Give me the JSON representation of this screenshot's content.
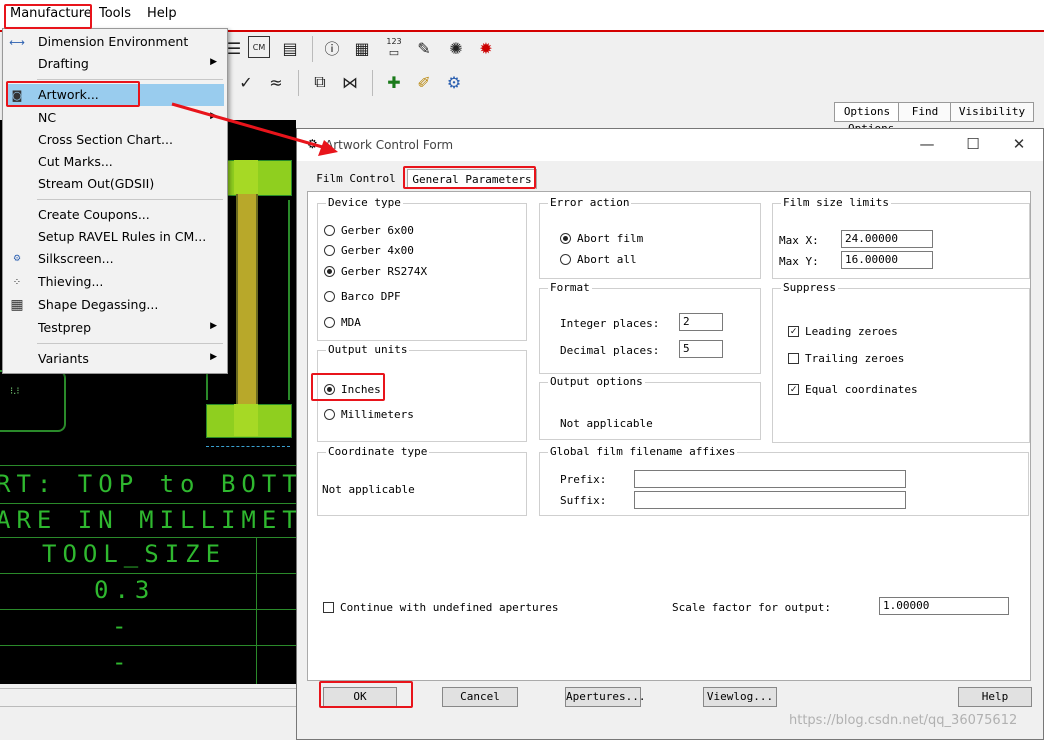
{
  "menubar": {
    "items": [
      "Manufacture",
      "Tools",
      "Help"
    ]
  },
  "menu": {
    "items": [
      {
        "label": "Dimension Environment",
        "icon": "dimension-icon",
        "submenu": false
      },
      {
        "label": "Drafting",
        "icon": "",
        "submenu": true
      },
      {
        "label": "Artwork...",
        "icon": "artwork-icon",
        "submenu": false
      },
      {
        "label": "NC",
        "icon": "",
        "submenu": true
      },
      {
        "label": "Cross Section Chart...",
        "icon": "",
        "submenu": false
      },
      {
        "label": "Cut Marks...",
        "icon": "",
        "submenu": false
      },
      {
        "label": "Stream Out(GDSII)",
        "icon": "",
        "submenu": false
      },
      {
        "label": "Create Coupons...",
        "icon": "",
        "submenu": false
      },
      {
        "label": "Setup RAVEL Rules in CM...",
        "icon": "",
        "submenu": false
      },
      {
        "label": "Silkscreen...",
        "icon": "silkscreen-icon",
        "submenu": false
      },
      {
        "label": "Thieving...",
        "icon": "thieving-icon",
        "submenu": false
      },
      {
        "label": "Shape Degassing...",
        "icon": "degassing-icon",
        "submenu": false
      },
      {
        "label": "Testprep",
        "icon": "",
        "submenu": true
      },
      {
        "label": "Variants",
        "icon": "",
        "submenu": true
      }
    ]
  },
  "toolbar": {
    "cm_label": "CM",
    "ruler_label": "123"
  },
  "right_panel": {
    "tabs": [
      "Options",
      "Find",
      "Visibility"
    ],
    "sub_label": "Options"
  },
  "canvas": {
    "lines": [
      "RT: TOP to BOTTOM",
      "ARE IN MILLIMETERS",
      "TOOL_SIZE",
      "0.3",
      "-",
      "-"
    ]
  },
  "dialog": {
    "title": "Artwork Control Form",
    "tabs": [
      "Film Control",
      "General Parameters"
    ],
    "active_tab": "General Parameters",
    "device_type": {
      "label": "Device type",
      "options": [
        "Gerber 6x00",
        "Gerber 4x00",
        "Gerber RS274X",
        "Barco DPF",
        "MDA"
      ],
      "selected": "Gerber RS274X"
    },
    "output_units": {
      "label": "Output units",
      "options": [
        "Inches",
        "Millimeters"
      ],
      "selected": "Inches"
    },
    "coordinate_type": {
      "label": "Coordinate type",
      "value": "Not applicable"
    },
    "error_action": {
      "label": "Error action",
      "options": [
        "Abort film",
        "Abort all"
      ],
      "selected": "Abort film"
    },
    "format": {
      "label": "Format",
      "integer_label": "Integer places:",
      "integer_value": "2",
      "decimal_label": "Decimal places:",
      "decimal_value": "5"
    },
    "output_options": {
      "label": "Output options",
      "value": "Not applicable"
    },
    "film_size": {
      "label": "Film size limits",
      "max_x_label": "Max X:",
      "max_x": "24.00000",
      "max_y_label": "Max Y:",
      "max_y": "16.00000"
    },
    "suppress": {
      "label": "Suppress",
      "options": [
        {
          "label": "Leading zeroes",
          "checked": true
        },
        {
          "label": "Trailing zeroes",
          "checked": false
        },
        {
          "label": "Equal coordinates",
          "checked": true
        }
      ]
    },
    "affixes": {
      "label": "Global film filename affixes",
      "prefix_label": "Prefix:",
      "prefix": "",
      "suffix_label": "Suffix:",
      "suffix": ""
    },
    "continue_label": "Continue with undefined apertures",
    "continue_checked": false,
    "scale_label": "Scale factor for output:",
    "scale_value": "1.00000",
    "buttons": [
      "OK",
      "Cancel",
      "Apertures...",
      "Viewlog...",
      "Help"
    ]
  },
  "watermark": "https://blog.csdn.net/qq_36075612",
  "colors": {
    "highlight_red": "#e8141b",
    "menu_selected": "#99ccee",
    "cad_green": "#2fb82f"
  }
}
